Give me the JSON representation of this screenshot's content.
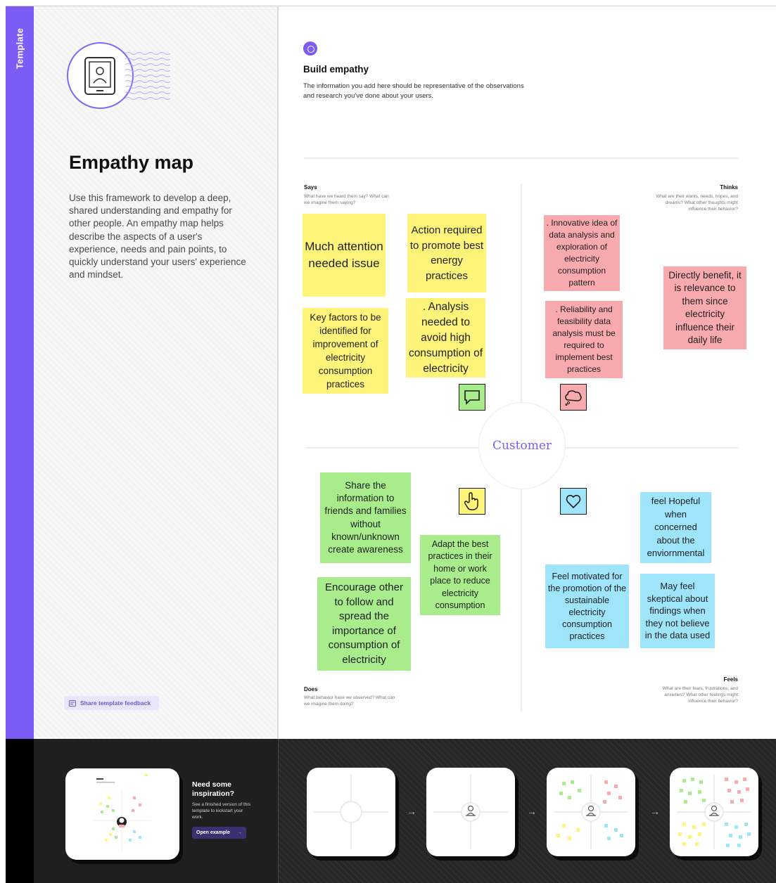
{
  "sidebar": {
    "badge": "Template",
    "title": "Empathy map",
    "description": "Use this framework to develop a deep, shared understanding and empathy for other people. An empathy map helps describe the aspects of a user's experience, needs and pain points, to quickly understand your users' experience and mindset.",
    "feedback_label": "Share template feedback"
  },
  "step": {
    "title": "Build empathy",
    "description": "The information you add here should be representative of the observations and research you've done about your users."
  },
  "quadrants": {
    "says": {
      "title": "Says",
      "sub": "What have we heard them say? What can we imagine them saying?"
    },
    "thinks": {
      "title": "Thinks",
      "sub": "What are their wants, needs, hopes, and dreams? What other thoughts might influence their behavior?"
    },
    "does": {
      "title": "Does",
      "sub": "What behavior have we observed? What can we imagine them doing?"
    },
    "feels": {
      "title": "Feels",
      "sub": "What are their fears, frustrations, and anxieties? What other feelings might influence their behavior?"
    }
  },
  "center_label": "Customer",
  "notes": {
    "says_1": "Much attention needed issue",
    "says_2": "Action required to promote best energy practices",
    "says_3": "Key factors  to be identified for improvement of electricity consumption practices",
    "says_4": ". Analysis needed to avoid high consumption of electricity",
    "thinks_1": ". Innovative idea of data analysis and exploration of electricity consumption pattern",
    "thinks_2": ". Reliability and feasibility data analysis must be required to implement best practices",
    "thinks_3": "Directly benefit, it is relevance to them since electricity influence their daily life",
    "does_1": "Share the information to friends and families without known/unknown create awareness",
    "does_2": "Adapt the best practices in their home or work place to reduce electricity consumption",
    "does_3": "Encourage other to follow and spread the importance of consumption of electricity",
    "feels_1": "feel Hopeful when concerned about the enviornmental",
    "feels_2": "Feel motivated for the promotion of the sustainable electricity consumption practices",
    "feels_3": "May feel skeptical about findings when they not believe in the data used"
  },
  "icons": {
    "says": "speech-bubble-icon",
    "thinks": "thought-bubble-icon",
    "does": "pointing-hand-icon",
    "feels": "heart-icon"
  },
  "colors": {
    "accent": "#7d5cf5",
    "says_notes": "#fef47a",
    "thinks_notes": "#f9aaae",
    "does_notes": "#a8ec8c",
    "feels_notes": "#9ee4fb"
  },
  "inspiration": {
    "title": "Need some inspiration?",
    "description": "See a finished version of this template to kickstart your work.",
    "button_label": "Open example"
  }
}
